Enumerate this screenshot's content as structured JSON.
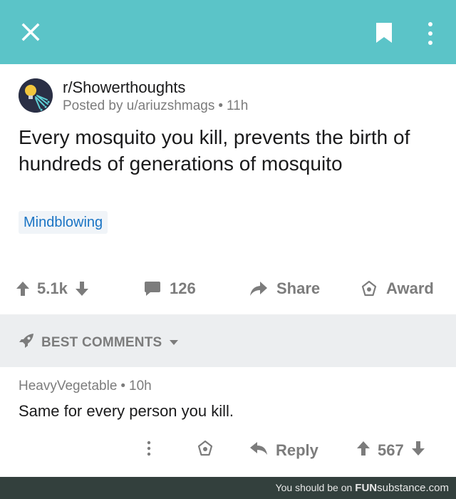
{
  "colors": {
    "topbar": "#5bc4c8",
    "flair_text": "#1a74c4",
    "muted": "#7c7c7c"
  },
  "topbar": {
    "close_icon": "close-icon",
    "bookmark_icon": "bookmark-icon",
    "more_icon": "more-vertical-icon"
  },
  "post": {
    "subreddit": "r/Showerthoughts",
    "posted_by": "Posted by u/ariuzshmags",
    "separator": "•",
    "age": "11h",
    "title": "Every mosquito you kill, prevents the birth of hundreds of generations of mosquito",
    "flair": "Mindblowing",
    "votes": "5.1k",
    "comments": "126",
    "share_label": "Share",
    "award_label": "Award"
  },
  "sort": {
    "label": "BEST COMMENTS"
  },
  "comment": {
    "author": "HeavyVegetable",
    "separator": "•",
    "age": "10h",
    "body": "Same for every person you kill.",
    "reply_label": "Reply",
    "votes": "567"
  },
  "footer": {
    "prefix": "You should be on",
    "brand_bold": "FUN",
    "brand_rest": "substance.com"
  }
}
